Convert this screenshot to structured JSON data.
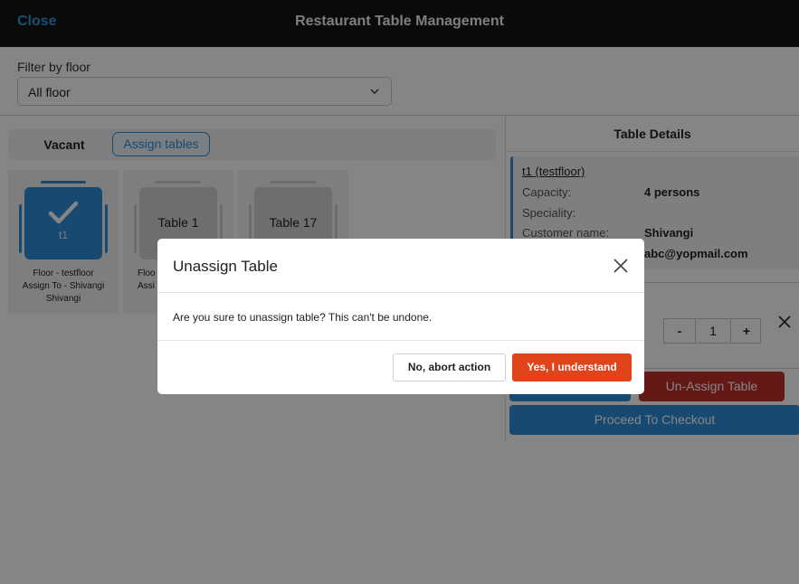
{
  "header": {
    "close_label": "Close",
    "title": "Restaurant Table Management"
  },
  "filter": {
    "label": "Filter by floor",
    "selected": "All floor"
  },
  "tabs": {
    "vacant": "Vacant",
    "assign": "Assign tables"
  },
  "tables": [
    {
      "name": "t1",
      "selected": true,
      "info": [
        "Floor - testfloor",
        "Assign To - Shivangi",
        "Shivangi"
      ]
    },
    {
      "name": "Table 1",
      "selected": false,
      "info": [
        "Floo",
        "Assi"
      ]
    },
    {
      "name": "Table 17",
      "selected": false,
      "info": []
    }
  ],
  "details": {
    "title": "Table Details",
    "table_ref": "t1 (testfloor)",
    "capacity_label": "Capacity:",
    "capacity_value": "4 persons",
    "speciality_label": "Speciality:",
    "customer_label": "Customer name:",
    "customer_value": "Shivangi",
    "email_value": "abc@yopmail.com"
  },
  "stepper": {
    "minus": "-",
    "value": "1",
    "plus": "+"
  },
  "actions": {
    "unassign_label": "Un-Assign Table",
    "checkout_label": "Proceed To Checkout"
  },
  "modal": {
    "title": "Unassign Table",
    "message": "Are you sure to unassign table? This can't be undone.",
    "abort_label": "No, abort action",
    "confirm_label": "Yes, I understand"
  },
  "colors": {
    "accent": "#2e8fd9",
    "danger": "#c0312b",
    "confirm": "#e0441b",
    "header_bg": "#151515"
  },
  "icons": {
    "close": "close-icon",
    "chevron": "chevron-down-icon",
    "check": "check-icon"
  }
}
